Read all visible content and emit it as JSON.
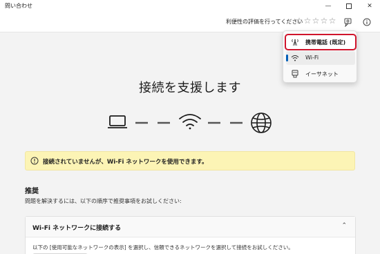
{
  "window": {
    "title": "問い合わせ"
  },
  "header": {
    "rating_label": "利便性の評価を行ってください",
    "stars": [
      "☆",
      "☆",
      "☆",
      "☆",
      "☆"
    ]
  },
  "main": {
    "headline": "接続を支援します",
    "banner_text": "接続されていませんが、Wi-Fi ネットワークを使用できます。",
    "recommend_title": "推奨",
    "recommend_desc": "問題を解決するには、以下の順序で推奨事項をお試しください:",
    "card": {
      "title": "Wi-Fi ネットワークに接続する",
      "chevron": "⌃",
      "body": "以下の [使用可能なネットワークの表示] を選択し、信頼できるネットワークを選択して接続をお試しください。"
    }
  },
  "menu": {
    "items": [
      {
        "label": "携帯電話 (既定)",
        "icon": "cellular-icon"
      },
      {
        "label": "Wi-Fi",
        "icon": "wifi-icon"
      },
      {
        "label": "イーサネット",
        "icon": "ethernet-icon"
      }
    ]
  },
  "colors": {
    "accent": "#005fb8",
    "banner_bg": "#fcf4b5",
    "highlight_red": "#d0142c"
  }
}
